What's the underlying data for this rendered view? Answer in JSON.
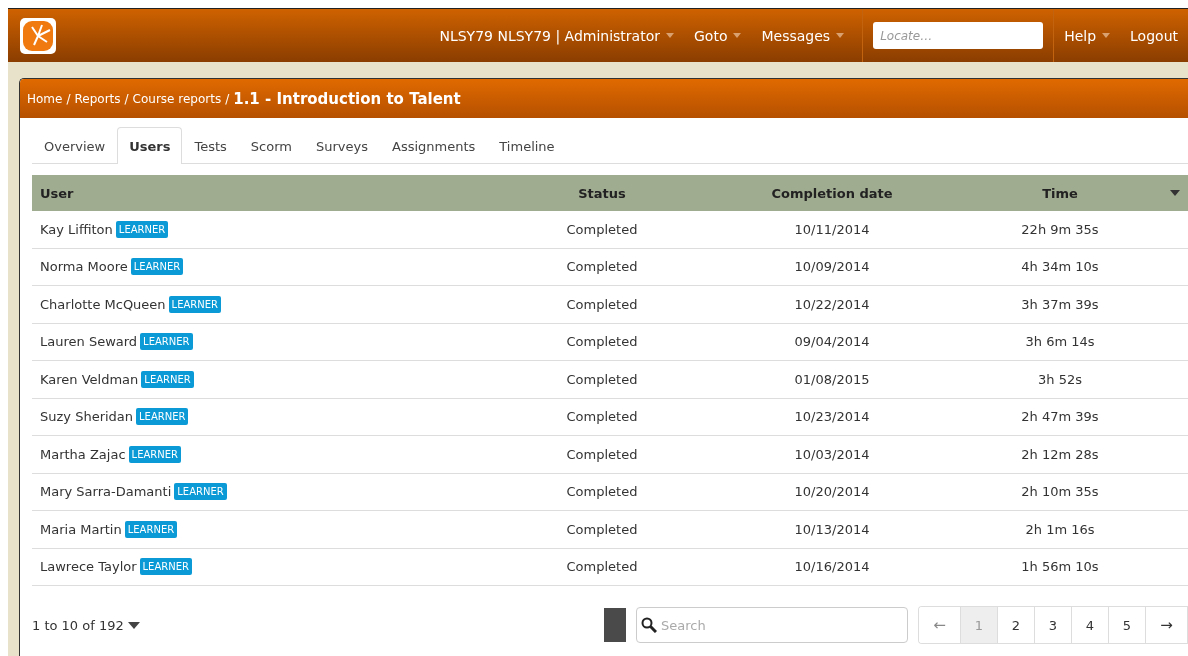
{
  "navbar": {
    "menus": [
      {
        "label": "NLSY79 NLSY79 | Administrator",
        "dropdown": true
      },
      {
        "label": "Goto",
        "dropdown": true
      },
      {
        "label": "Messages",
        "dropdown": true
      }
    ],
    "locate": {
      "placeholder": "Locate…"
    },
    "right_menus": [
      {
        "label": "Help",
        "dropdown": true
      },
      {
        "label": "Logout",
        "dropdown": false
      }
    ]
  },
  "breadcrumb": {
    "links": [
      "Home",
      "Reports",
      "Course reports"
    ],
    "separator": "/",
    "current": "1.1 - Introduction to Talent"
  },
  "tabs": [
    {
      "label": "Overview",
      "selected": false
    },
    {
      "label": "Users",
      "selected": true
    },
    {
      "label": "Tests",
      "selected": false
    },
    {
      "label": "Scorm",
      "selected": false
    },
    {
      "label": "Surveys",
      "selected": false
    },
    {
      "label": "Assignments",
      "selected": false
    },
    {
      "label": "Timeline",
      "selected": false
    }
  ],
  "table": {
    "columns": [
      "User",
      "Status",
      "Completion date",
      "Time"
    ],
    "rows": [
      {
        "user": "Kay Liffiton",
        "badge": "LEARNER",
        "status": "Completed",
        "date": "10/11/2014",
        "time": "22h 9m 35s"
      },
      {
        "user": "Norma Moore",
        "badge": "LEARNER",
        "status": "Completed",
        "date": "10/09/2014",
        "time": "4h 34m 10s"
      },
      {
        "user": "Charlotte McQueen",
        "badge": "LEARNER",
        "status": "Completed",
        "date": "10/22/2014",
        "time": "3h 37m 39s"
      },
      {
        "user": "Lauren Seward",
        "badge": "LEARNER",
        "status": "Completed",
        "date": "09/04/2014",
        "time": "3h 6m 14s"
      },
      {
        "user": "Karen Veldman",
        "badge": "LEARNER",
        "status": "Completed",
        "date": "01/08/2015",
        "time": "3h 52s"
      },
      {
        "user": "Suzy Sheridan",
        "badge": "LEARNER",
        "status": "Completed",
        "date": "10/23/2014",
        "time": "2h 47m 39s"
      },
      {
        "user": "Martha Zajac",
        "badge": "LEARNER",
        "status": "Completed",
        "date": "10/03/2014",
        "time": "2h 12m 28s"
      },
      {
        "user": "Mary Sarra-Damanti",
        "badge": "LEARNER",
        "status": "Completed",
        "date": "10/20/2014",
        "time": "2h 10m 35s"
      },
      {
        "user": "Maria Martin",
        "badge": "LEARNER",
        "status": "Completed",
        "date": "10/13/2014",
        "time": "2h 1m 16s"
      },
      {
        "user": "Lawrece Taylor",
        "badge": "LEARNER",
        "status": "Completed",
        "date": "10/16/2014",
        "time": "1h 56m 10s"
      }
    ]
  },
  "footer": {
    "range": "1 to 10 of 192",
    "search": {
      "placeholder": "Search"
    },
    "pages": [
      {
        "label": "←",
        "kind": "arrow",
        "disabled": true,
        "selected": false
      },
      {
        "label": "1",
        "kind": "page",
        "disabled": false,
        "selected": true
      },
      {
        "label": "2",
        "kind": "page",
        "disabled": false,
        "selected": false
      },
      {
        "label": "3",
        "kind": "page",
        "disabled": false,
        "selected": false
      },
      {
        "label": "4",
        "kind": "page",
        "disabled": false,
        "selected": false
      },
      {
        "label": "5",
        "kind": "page",
        "disabled": false,
        "selected": false
      },
      {
        "label": "→",
        "kind": "arrow",
        "disabled": false,
        "selected": false
      }
    ]
  }
}
